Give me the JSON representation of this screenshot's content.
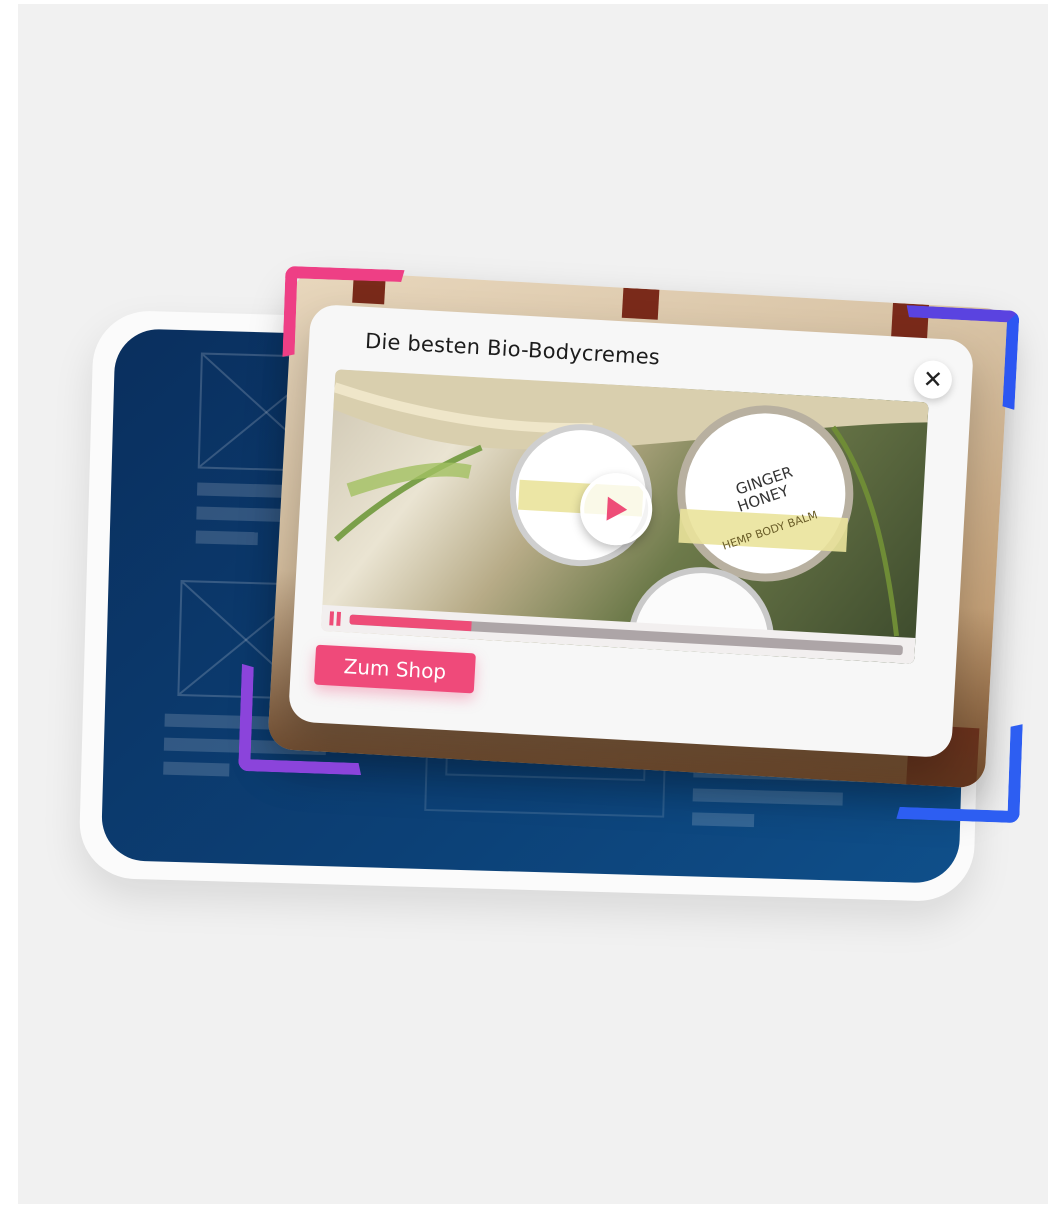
{
  "popup": {
    "title": "Die besten Bio-Bodycremes",
    "close_symbol": "✕",
    "cta_label": "Zum Shop"
  },
  "video": {
    "progress": 0.22,
    "state": "playing",
    "product_jar_center": {
      "line1": "GINGER",
      "line2": "HONEY",
      "line3": "HEMP BODY BALM"
    }
  },
  "icons": {
    "close": "close-icon",
    "play": "play-icon",
    "pause": "pause-icon"
  },
  "colors": {
    "accent_pink": "#ef4a7a",
    "backdrop_navy": "#0c4177",
    "bracket_pink": "#ee3f85",
    "bracket_purple": "#8b44db",
    "bracket_blue": "#2d5ef2"
  }
}
